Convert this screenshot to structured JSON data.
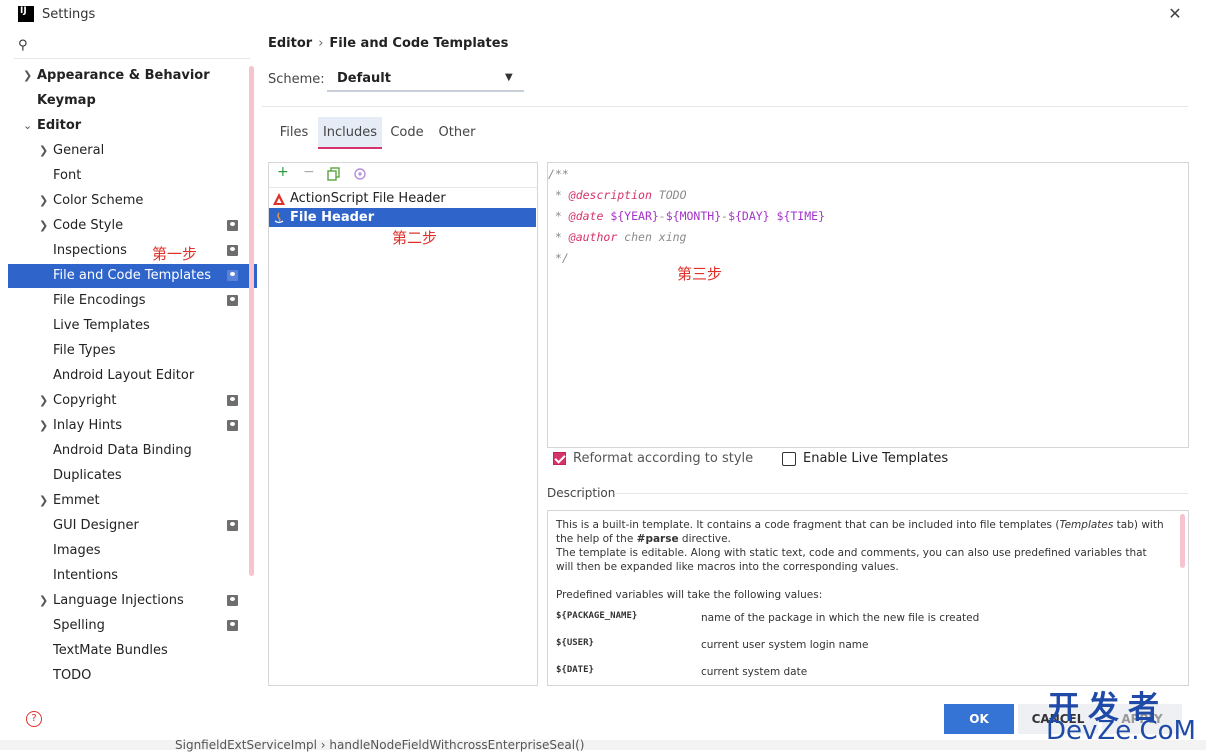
{
  "window": {
    "title": "Settings",
    "logo_text": "IJ",
    "close_symbol": "✕"
  },
  "sidebar": {
    "search_icon": "search-icon",
    "items": [
      {
        "label": "Appearance & Behavior"
      },
      {
        "label": "Keymap"
      },
      {
        "label": "Editor"
      },
      {
        "label": "General"
      },
      {
        "label": "Font"
      },
      {
        "label": "Color Scheme"
      },
      {
        "label": "Code Style"
      },
      {
        "label": "Inspections"
      },
      {
        "label": "File and Code Templates"
      },
      {
        "label": "File Encodings"
      },
      {
        "label": "Live Templates"
      },
      {
        "label": "File Types"
      },
      {
        "label": "Android Layout Editor"
      },
      {
        "label": "Copyright"
      },
      {
        "label": "Inlay Hints"
      },
      {
        "label": "Android Data Binding"
      },
      {
        "label": "Duplicates"
      },
      {
        "label": "Emmet"
      },
      {
        "label": "GUI Designer"
      },
      {
        "label": "Images"
      },
      {
        "label": "Intentions"
      },
      {
        "label": "Language Injections"
      },
      {
        "label": "Spelling"
      },
      {
        "label": "TextMate Bundles"
      },
      {
        "label": "TODO"
      }
    ],
    "selected": "File and Code Templates"
  },
  "annotations": {
    "step1": "第一步",
    "step2": "第二步",
    "step3": "第三步"
  },
  "breadcrumb": {
    "parent": "Editor",
    "sep": "›",
    "current": "File and Code Templates"
  },
  "scheme": {
    "label": "Scheme:",
    "value": "Default"
  },
  "tabs": [
    {
      "label": "Files"
    },
    {
      "label": "Includes"
    },
    {
      "label": "Code"
    },
    {
      "label": "Other"
    }
  ],
  "active_tab": "Includes",
  "toolbar": {
    "add": "+",
    "remove": "−"
  },
  "templates": [
    {
      "label": "ActionScript File Header"
    },
    {
      "label": "File Header"
    }
  ],
  "selected_template": "File Header",
  "editor": {
    "line1": "/**",
    "line2_prefix": " * ",
    "line2_tag": "@description",
    "line2_text": " TODO",
    "line3_prefix": " * ",
    "line3_tag": "@date",
    "line3_v1": " ${YEAR}",
    "line3_d1": "-",
    "line3_v2": "${MONTH}",
    "line3_d2": "-",
    "line3_v3": "${DAY}",
    "line3_v4": " ${TIME}",
    "line4_prefix": " * ",
    "line4_tag": "@author",
    "line4_text": " chen xing",
    "line5": " */"
  },
  "options": {
    "reformat_label": "Reformat according to style",
    "reformat_checked": true,
    "live_label": "Enable Live Templates",
    "live_checked": false
  },
  "description": {
    "label": "Description",
    "p1_a": "This is a built-in template. It contains a code fragment that can be included into file templates (",
    "p1_b": "Templates",
    "p1_c": " tab) with the help of the ",
    "p1_d": "#parse",
    "p1_e": " directive.",
    "p2": "The template is editable. Along with static text, code and comments, you can also use predefined variables that will then be expanded like macros into the corresponding values.",
    "p3": "Predefined variables will take the following values:",
    "vars": [
      {
        "name": "${PACKAGE_NAME}",
        "desc": "name of the package in which the new file is created"
      },
      {
        "name": "${USER}",
        "desc": "current user system login name"
      },
      {
        "name": "${DATE}",
        "desc": "current system date"
      }
    ]
  },
  "buttons": {
    "ok": "OK",
    "cancel": "CANCEL",
    "apply": "APPLY"
  },
  "watermark": {
    "top": "开发者",
    "bottom": "DevZe.CoM"
  },
  "status": {
    "text": "SignfieldExtServiceImpl  ›  handleNodeFieldWithcrossEnterpriseSeal()"
  },
  "colors": {
    "accent": "#2f65ca",
    "highlight": "#d6336c",
    "annotation": "#e0302a",
    "watermark": "#1f4aa8"
  }
}
